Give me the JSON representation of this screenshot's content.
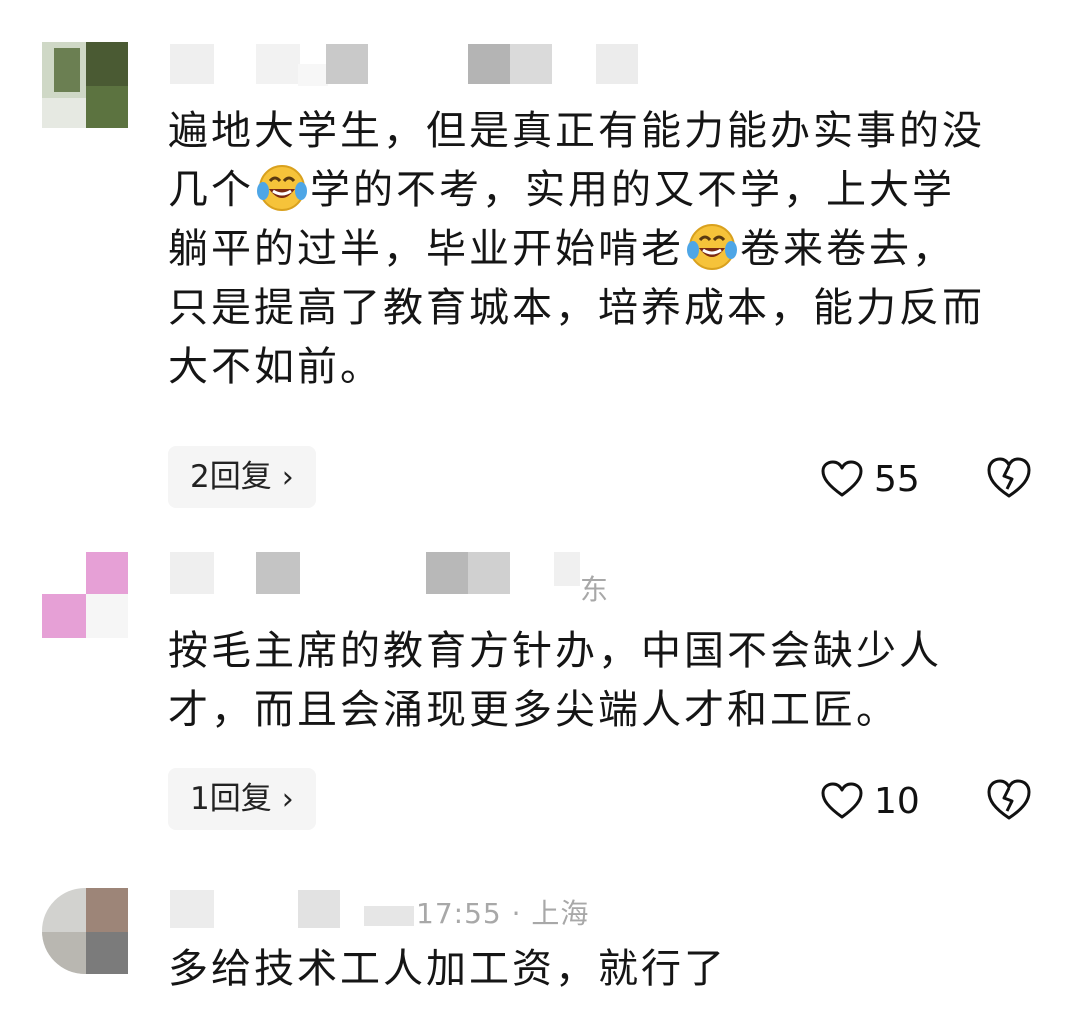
{
  "comments": [
    {
      "lines": [
        "遍地大学生，但是真正有能力能办实事的没",
        "几个",
        "学的不考，实用的又不学，上大学",
        "躺平的过半，毕业开始啃老",
        "卷来卷去，",
        "只是提高了教育城本，培养成本，能力反而",
        "大不如前。"
      ],
      "reply_label": "2回复",
      "likes": "55",
      "emoji": "laughing-crying-emoji"
    },
    {
      "meta_region": "东",
      "lines": [
        "按毛主席的教育方针办，中国不会缺少人",
        "才，而且会涌现更多尖端人才和工匠。"
      ],
      "reply_label": "1回复",
      "likes": "10"
    },
    {
      "meta_time": "17:55 · 上海",
      "lines": [
        "多给技术工人加工资，就行了"
      ]
    }
  ],
  "icons": {
    "like": "heart-outline-icon",
    "dislike": "broken-heart-icon",
    "reply_chevron": "chevron-right-icon"
  },
  "colors": {
    "reply_bg": "#f5f5f5",
    "meta_text": "#a8a8a8",
    "emoji_face": "#f6c33a"
  }
}
